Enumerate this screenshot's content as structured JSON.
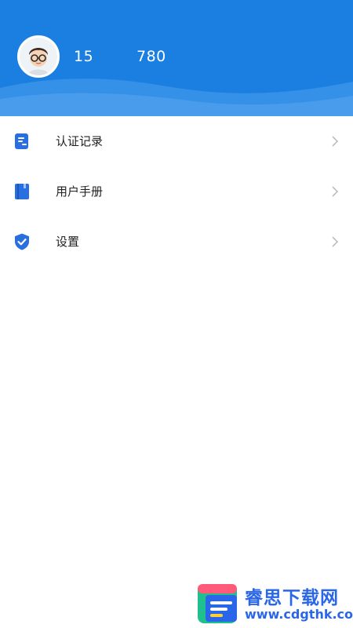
{
  "profile": {
    "phone_prefix": "15",
    "phone_suffix": "780",
    "avatar_icon": "cartoon-boy-avatar"
  },
  "menu": {
    "items": [
      {
        "label": "认证记录",
        "icon": "document-list-icon"
      },
      {
        "label": "用户手册",
        "icon": "book-icon"
      },
      {
        "label": "设置",
        "icon": "shield-check-icon"
      }
    ],
    "chevron_icon": "chevron-right-icon"
  },
  "watermark": {
    "title": "睿思下载网",
    "url": "www.cdgthk.com"
  },
  "colors": {
    "header_blue": "#1a7fe0",
    "icon_blue": "#2a6fe0",
    "chevron": "#b8b8b8"
  }
}
